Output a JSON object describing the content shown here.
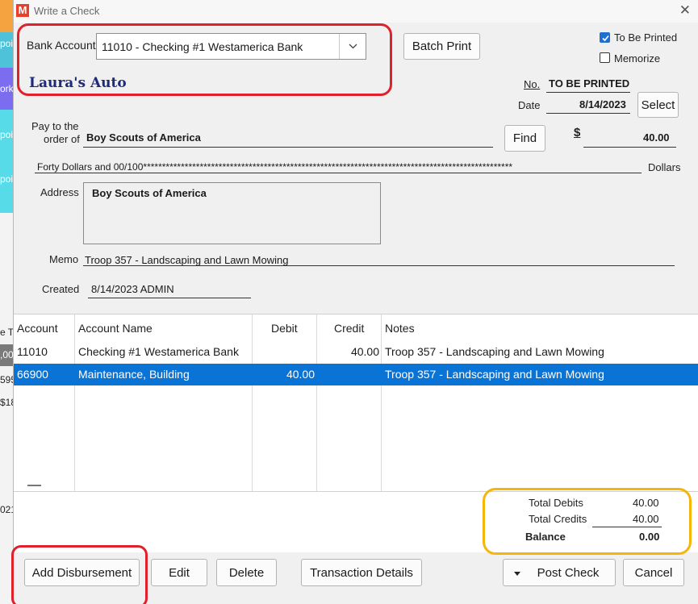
{
  "window": {
    "title": "Write a Check"
  },
  "header": {
    "bank_account_label": "Bank Account",
    "bank_account_value": "11010 - Checking #1 Westamerica Bank",
    "batch_print_label": "Batch Print",
    "to_be_printed_label": "To Be Printed",
    "to_be_printed_checked": true,
    "memorize_label": "Memorize",
    "memorize_checked": false
  },
  "check": {
    "company": "Laura's Auto",
    "no_label": "No.",
    "no_value": "TO BE PRINTED",
    "date_label": "Date",
    "date_value": "8/14/2023",
    "select_label": "Select",
    "pay_to_label_1": "Pay to the",
    "pay_to_label_2": "order of",
    "payee": "Boy Scouts of America",
    "find_label": "Find",
    "dollar_sign": "$",
    "amount": "40.00",
    "amount_words": "Forty Dollars and 00/100**************************************************************************************************",
    "dollars_label": "Dollars",
    "address_label": "Address",
    "address_value": "Boy Scouts of America",
    "memo_label": "Memo",
    "memo_value": "Troop 357 - Landscaping and Lawn Mowing",
    "created_label": "Created",
    "created_value": "8/14/2023  ADMIN"
  },
  "grid": {
    "columns": [
      "Account",
      "Account Name",
      "Debit",
      "Credit",
      "Notes"
    ],
    "rows": [
      {
        "account": "11010",
        "name": "Checking #1 Westamerica Bank",
        "debit": "",
        "credit": "40.00",
        "notes": "Troop 357 - Landscaping and Lawn Mowing",
        "selected": false
      },
      {
        "account": "66900",
        "name": "Maintenance, Building",
        "debit": "40.00",
        "credit": "",
        "notes": "Troop 357 - Landscaping and Lawn Mowing",
        "selected": true
      }
    ]
  },
  "totals": {
    "debits_label": "Total Debits",
    "debits_value": "40.00",
    "credits_label": "Total Credits",
    "credits_value": "40.00",
    "balance_label": "Balance",
    "balance_value": "0.00"
  },
  "footer": {
    "add_disbursement_label": "Add Disbursement",
    "edit_label": "Edit",
    "delete_label": "Delete",
    "transaction_details_label": "Transaction Details",
    "post_check_label": "Post Check",
    "cancel_label": "Cancel"
  },
  "background": {
    "fragments": [
      "poi",
      "ork",
      "poi",
      "poi",
      "e T",
      ",00",
      "595",
      "$18",
      "021"
    ]
  },
  "colors": {
    "selection": "#0a74d6",
    "company_text": "#1e2a7a",
    "annotation_red": "#e0202a",
    "annotation_orange": "#f5b50a"
  }
}
